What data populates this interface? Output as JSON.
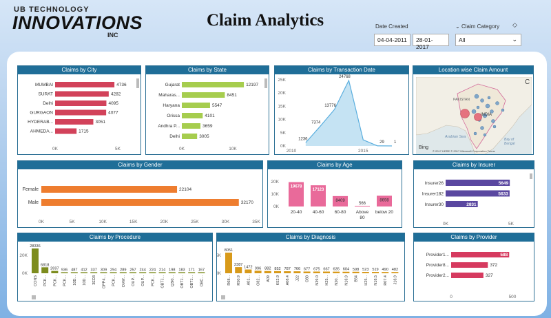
{
  "header": {
    "logo_line1": "UB TECHNOLOGY",
    "logo_line2": "INNOVATIONS",
    "logo_line3": "INC",
    "title": "Claim Analytics"
  },
  "filters": {
    "date_label": "Date Created",
    "date_from": "04-04-2011",
    "date_to": "28-01-2017",
    "category_label": "Claim Category",
    "category_value": "All"
  },
  "cards": {
    "city": {
      "title": "Claims by City",
      "ticks": [
        "0K",
        "5K"
      ]
    },
    "state": {
      "title": "Claims by State",
      "ticks": [
        "0K",
        "10K"
      ]
    },
    "txn": {
      "title": "Claims by Transaction Date"
    },
    "location": {
      "title": "Location wise Claim Amount",
      "labels": {
        "pakistan": "PAKISTAN",
        "india": "INDIA",
        "arabian_sea": "Arabian Sea",
        "bay": "Bay of",
        "bengal": "Bengal",
        "bing": "Bing",
        "copyright": "© 2017 HERE © 2017 Microsoft Corporation Terms"
      }
    },
    "gender": {
      "title": "Claims by Gender"
    },
    "age": {
      "title": "Claims by Age"
    },
    "insurer": {
      "title": "Claims by Insurer",
      "ticks": [
        "0K",
        "5K"
      ]
    },
    "procedure": {
      "title": "Claims by Procedure"
    },
    "diagnosis": {
      "title": "Claims by Diagnosis"
    },
    "provider": {
      "title": "Claims by Provider",
      "ticks": [
        "0",
        "500"
      ]
    }
  },
  "colors": {
    "city": "#d2425a",
    "state": "#a6cd4e",
    "txn": "#5aaede",
    "gender": "#ee7d2f",
    "age": "#e96a9a",
    "insurer": "#5a47a0",
    "procedure": "#7d8c1e",
    "diagnosis": "#d89a1a",
    "provider": "#d63a5f",
    "header": "#1f6e98"
  },
  "chart_data": [
    {
      "id": "city",
      "type": "bar",
      "orientation": "horizontal",
      "categories": [
        "MUMBAI",
        "SURAT",
        "Delhi",
        "GURGAON",
        "HYDERAB...",
        "AHMEDA..."
      ],
      "values": [
        4736,
        4282,
        4095,
        4077,
        3051,
        1715
      ],
      "xlim": [
        0,
        5500
      ]
    },
    {
      "id": "state",
      "type": "bar",
      "orientation": "horizontal",
      "categories": [
        "Gujarat",
        "Maharas...",
        "Haryana",
        "Orissa",
        "Andhra P...",
        "Delhi"
      ],
      "values": [
        12197,
        8451,
        5547,
        4101,
        3659,
        3005
      ],
      "xlim": [
        0,
        13000
      ]
    },
    {
      "id": "txn",
      "type": "area",
      "x": [
        2010,
        2011,
        2012,
        2013,
        2014,
        2015,
        2016,
        2017
      ],
      "values": [
        null,
        1236,
        7374,
        13776,
        24768,
        2300,
        29,
        1
      ],
      "labels": [
        "",
        "1236",
        "7374",
        "13776",
        "24768",
        "",
        "29",
        "1"
      ],
      "yticks": [
        "0K",
        "5K",
        "10K",
        "15K",
        "20K",
        "25K"
      ],
      "xticks": [
        "2010",
        "2015"
      ],
      "ylim": [
        0,
        25000
      ]
    },
    {
      "id": "gender",
      "type": "bar",
      "orientation": "horizontal",
      "categories": [
        "Female",
        "Male"
      ],
      "values": [
        22104,
        32170
      ],
      "xticks": [
        "0K",
        "5K",
        "10K",
        "15K",
        "20K",
        "25K",
        "30K",
        "35K"
      ],
      "xlim": [
        0,
        35000
      ]
    },
    {
      "id": "age",
      "type": "bar",
      "categories": [
        "20-40",
        "40-60",
        "60-80",
        "Above 80",
        "below 20"
      ],
      "values": [
        19678,
        17123,
        8409,
        566,
        8698
      ],
      "yticks": [
        "0K",
        "10K",
        "20K"
      ],
      "ylim": [
        0,
        20000
      ]
    },
    {
      "id": "insurer",
      "type": "bar",
      "orientation": "horizontal",
      "categories": [
        "Insurer26",
        "Insurer182",
        "Insurer30"
      ],
      "values": [
        5649,
        5633,
        2831
      ],
      "xlim": [
        0,
        5700
      ]
    },
    {
      "id": "procedure",
      "type": "bar",
      "categories": [
        "CONS",
        "PCK...",
        "PCK...",
        "PCK...",
        "10D...",
        "10D...",
        "3ED3",
        "OPP4...",
        "PCK...",
        "OVW...",
        "OUP...",
        "OUP...",
        "PCK...",
        "OBTJ...",
        "Q3I0...",
        "OBTJ...",
        "OBTJ...",
        "OBC..."
      ],
      "values": [
        28336,
        6818,
        2697,
        936,
        487,
        412,
        337,
        309,
        294,
        289,
        257,
        244,
        224,
        214,
        198,
        183,
        171,
        167
      ],
      "yticks": [
        "0K",
        "20K"
      ],
      "ylim": [
        0,
        28336
      ]
    },
    {
      "id": "diagnosis",
      "type": "bar",
      "categories": [
        "R68...",
        "R50.9",
        "A01...",
        "O82...",
        "A09",
        "K52.9",
        "A08.4",
        "J22",
        "O80",
        "N39.0",
        "H25...",
        "N20...",
        "N18.9",
        "B54",
        "H25...",
        "N18.5",
        "R07.4",
        "J18.9"
      ],
      "values": [
        8051,
        2387,
        1472,
        996,
        882,
        852,
        787,
        766,
        677,
        675,
        667,
        635,
        604,
        598,
        523,
        519,
        490,
        482
      ],
      "yticks": [
        "0K",
        "5K"
      ],
      "ylim": [
        0,
        8051
      ]
    },
    {
      "id": "provider",
      "type": "bar",
      "orientation": "horizontal",
      "categories": [
        "Provider1...",
        "Provider8...",
        "Provider2..."
      ],
      "values": [
        588,
        372,
        327
      ],
      "xlim": [
        0,
        600
      ]
    }
  ]
}
